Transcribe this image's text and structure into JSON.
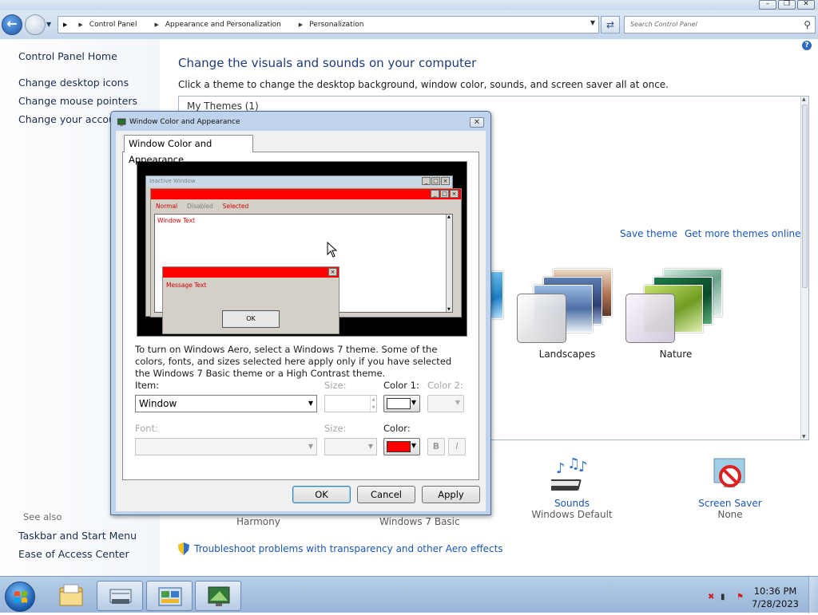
{
  "window": {
    "caption_min": "–",
    "caption_max": "❐",
    "caption_close": "✕"
  },
  "address": {
    "breadcrumbs": [
      "Control Panel",
      "Appearance and Personalization",
      "Personalization"
    ],
    "search_placeholder": "Search Control Panel"
  },
  "leftnav": {
    "home": "Control Panel Home",
    "items": [
      "Change desktop icons",
      "Change mouse pointers",
      "Change your account"
    ],
    "see_also": "See also",
    "see_also_items": [
      "Taskbar and Start Menu",
      "Ease of Access Center"
    ]
  },
  "main": {
    "title": "Change the visuals and sounds on your computer",
    "subtitle": "Click a theme to change the desktop background, window color, sounds, and screen saver all at once.",
    "my_themes": "My Themes (1)",
    "save_theme": "Save theme",
    "get_more": "Get more themes online",
    "themes": [
      {
        "name": "Landscapes"
      },
      {
        "name": "Nature"
      }
    ],
    "bottom": {
      "harmony": "Harmony",
      "basic": "Windows 7 Basic",
      "sounds_label": "Sounds",
      "sounds_value": "Windows Default",
      "saver_label": "Screen Saver",
      "saver_value": "None"
    },
    "troubleshoot": "Troubleshoot problems with transparency and other Aero effects"
  },
  "dialog": {
    "title": "Window Color and Appearance",
    "tab": "Window Color and Appearance",
    "preview": {
      "inactive_title": "Inactive Window",
      "menu_normal": "Normal",
      "menu_disabled": "Disabled",
      "menu_selected": "Selected",
      "window_text": "Window Text",
      "message_text": "Message Text",
      "ok": "OK"
    },
    "info": "To turn on Windows Aero, select a Windows 7 theme.  Some of the colors, fonts, and sizes selected here apply only if you have selected the Windows 7 Basic theme or a High Contrast theme.",
    "item_label": "Item:",
    "item_value": "Window",
    "size_label": "Size:",
    "color1_label": "Color 1:",
    "color2_label": "Color 2:",
    "font_label": "Font:",
    "size2_label": "Size:",
    "color_label": "Color:",
    "bold": "B",
    "italic": "I",
    "ok": "OK",
    "cancel": "Cancel",
    "apply": "Apply",
    "colors": {
      "color1": "#ffffff",
      "font_color": "#ff0000",
      "titlebar": "#ff0000"
    }
  },
  "taskbar": {
    "time": "10:36 PM",
    "date": "7/28/2023"
  }
}
